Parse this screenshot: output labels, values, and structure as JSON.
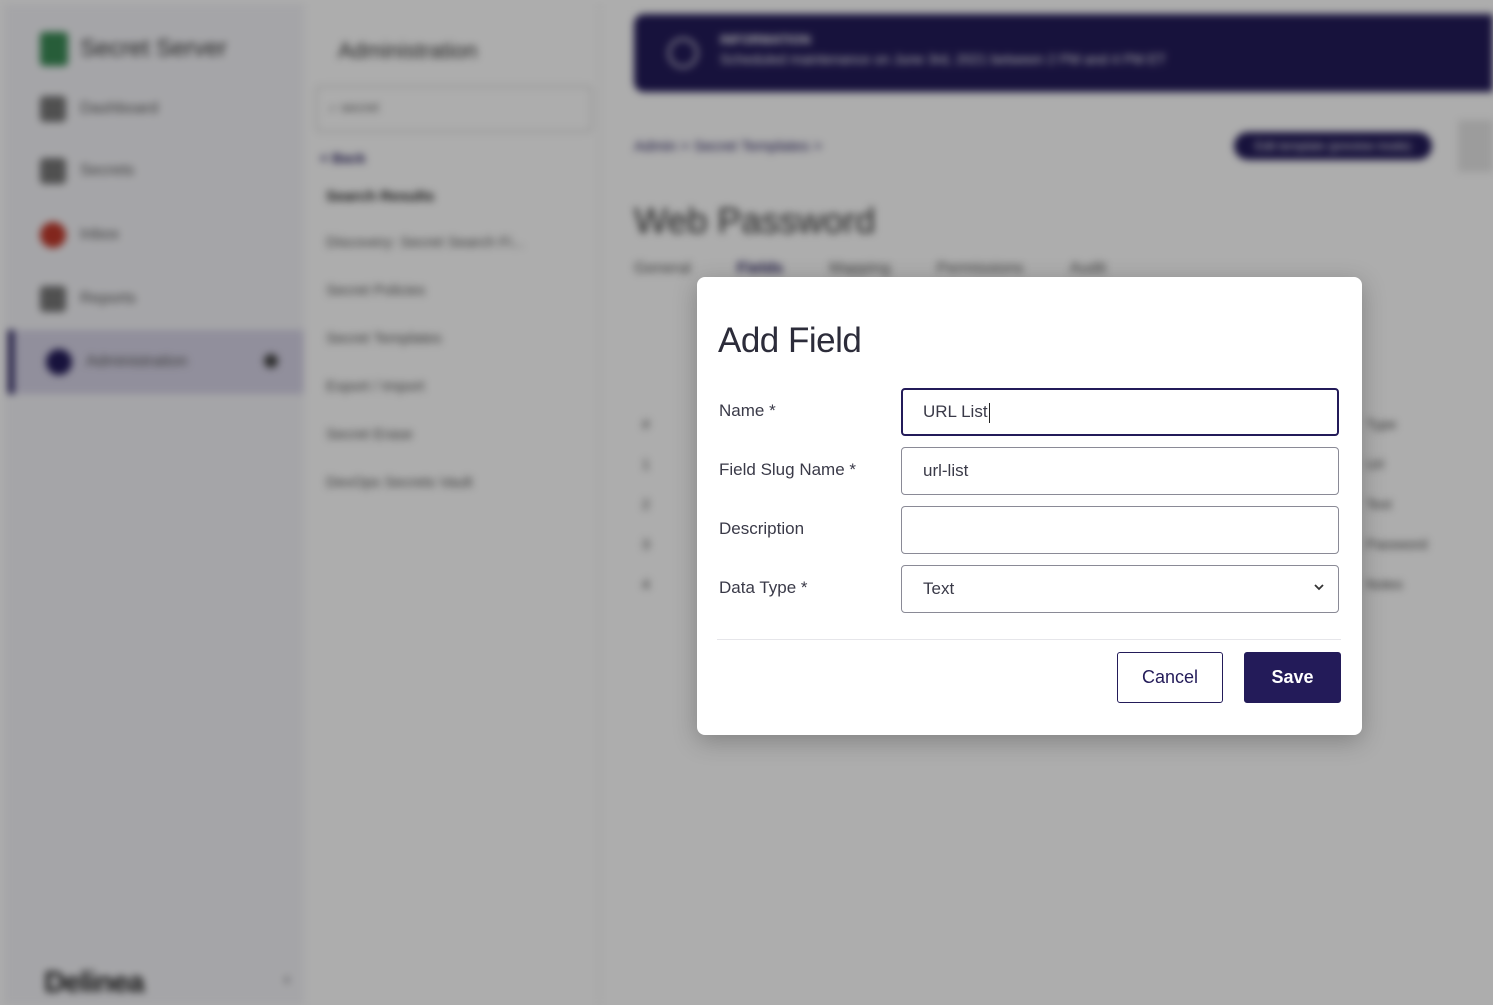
{
  "background": {
    "nav": {
      "brand": "Secret Server",
      "items": [
        {
          "label": "Dashboard",
          "icon": "dashboard-icon"
        },
        {
          "label": "Secrets",
          "icon": "lock-icon"
        },
        {
          "label": "Inbox",
          "icon": "inbox-icon"
        },
        {
          "label": "Reports",
          "icon": "chart-icon"
        },
        {
          "label": "Administration",
          "icon": "gear-icon"
        }
      ],
      "footer_logo": "Delinea"
    },
    "sub": {
      "title": "Administration",
      "search_value": "secret",
      "back": "< Back",
      "links": [
        "Search Results",
        "Discovery: Secret Search Fi...",
        "Secret Policies",
        "Secret Templates",
        "Export / Import",
        "Secret Erase",
        "DevOps Secrets Vault"
      ]
    },
    "main": {
      "banner_title": "INFORMATION",
      "banner_text": "Scheduled maintenance on June 3rd, 2021 between 2 PM and 4 PM ET",
      "breadcrumb": "Admin > Secret Templates >",
      "pill": "Edit template (preview mode)",
      "page_title": "Web Password",
      "tabs": [
        "General",
        "Fields",
        "Mapping",
        "Permissions",
        "Audit"
      ],
      "row_nums": [
        "#",
        "1",
        "2",
        "3",
        "4"
      ],
      "right_col": [
        "Type",
        "Url",
        "Text",
        "Password",
        "Notes"
      ]
    }
  },
  "modal": {
    "title": "Add Field",
    "name_label": "Name *",
    "name_value": "URL List",
    "slug_label": "Field Slug Name *",
    "slug_value": "url-list",
    "description_label": "Description",
    "description_value": "",
    "datatype_label": "Data Type *",
    "datatype_value": "Text",
    "cancel_label": "Cancel",
    "save_label": "Save"
  },
  "colors": {
    "primary": "#231b59",
    "overlay": "rgba(0,0,0,0.32)"
  }
}
